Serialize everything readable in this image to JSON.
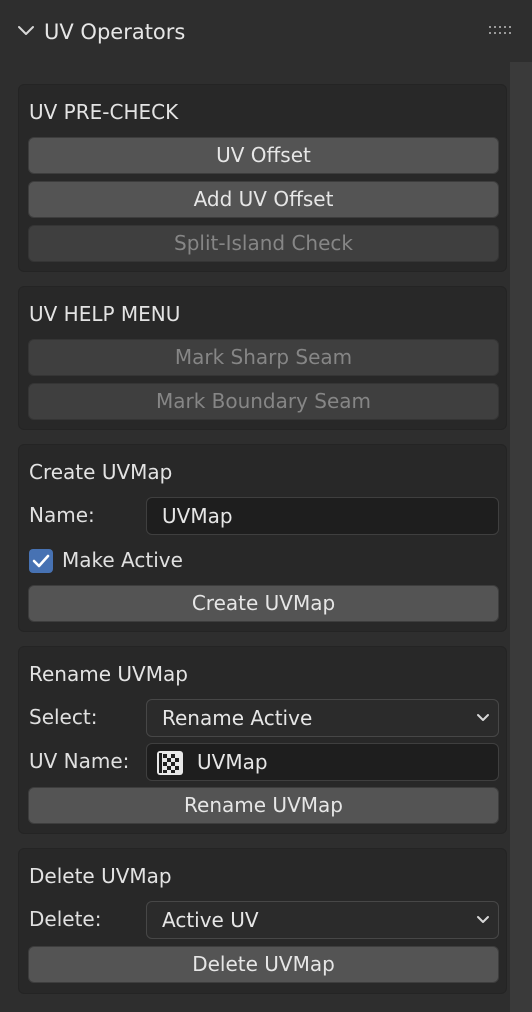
{
  "panel": {
    "title": "UV Operators",
    "icons": {
      "collapse": "chevron-down-icon",
      "drag": "grip-dots-icon"
    }
  },
  "uv_precheck": {
    "title": "UV PRE-CHECK",
    "buttons": [
      {
        "label": "UV Offset",
        "enabled": true
      },
      {
        "label": "Add UV Offset",
        "enabled": true
      },
      {
        "label": "Split-Island Check",
        "enabled": false
      }
    ]
  },
  "uv_help_menu": {
    "title": "UV HELP MENU",
    "buttons": [
      {
        "label": "Mark Sharp Seam",
        "enabled": false
      },
      {
        "label": "Mark Boundary Seam",
        "enabled": false
      }
    ]
  },
  "create_uvmap": {
    "title": "Create UVMap",
    "name_label": "Name:",
    "name_value": "UVMap",
    "make_active_label": "Make Active",
    "make_active_checked": true,
    "button": "Create UVMap"
  },
  "rename_uvmap": {
    "title": "Rename UVMap",
    "select_label": "Select:",
    "select_value": "Rename Active",
    "uv_name_label": "UV Name:",
    "uv_name_value": "UVMap",
    "uv_name_icon": "checker-texture-icon",
    "button": "Rename UVMap"
  },
  "delete_uvmap": {
    "title": "Delete UVMap",
    "delete_label": "Delete:",
    "delete_value": "Active UV",
    "button": "Delete UVMap"
  },
  "colors": {
    "background": "#2e2e2e",
    "box": "#282828",
    "button": "#545454",
    "button_disabled": "#3f3f3f",
    "checkbox_accent": "#4772b3",
    "text_field": "#1e1e1e"
  }
}
